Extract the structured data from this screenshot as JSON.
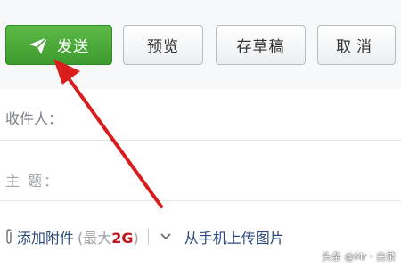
{
  "toolbar": {
    "send_label": "发送",
    "preview_label": "预览",
    "draft_label": "存草稿",
    "cancel_label": "取消"
  },
  "form": {
    "recipient_label": "收件人：",
    "subject_label": "主 题："
  },
  "attachment": {
    "add_label": "添加附件",
    "limit_prefix": "(最大",
    "limit_size": "2G",
    "limit_suffix": ")",
    "upload_label": "从手机上传图片"
  },
  "watermark": "头条 @Mr · 白茶",
  "colors": {
    "send_button": "#3c9b2d",
    "annotation_arrow": "#d91d1d",
    "link": "#2b4a7a",
    "size_highlight": "#c0141e"
  },
  "icons": {
    "send": "paper-plane-icon",
    "attach": "paperclip-icon",
    "expand": "chevron-down-icon"
  }
}
